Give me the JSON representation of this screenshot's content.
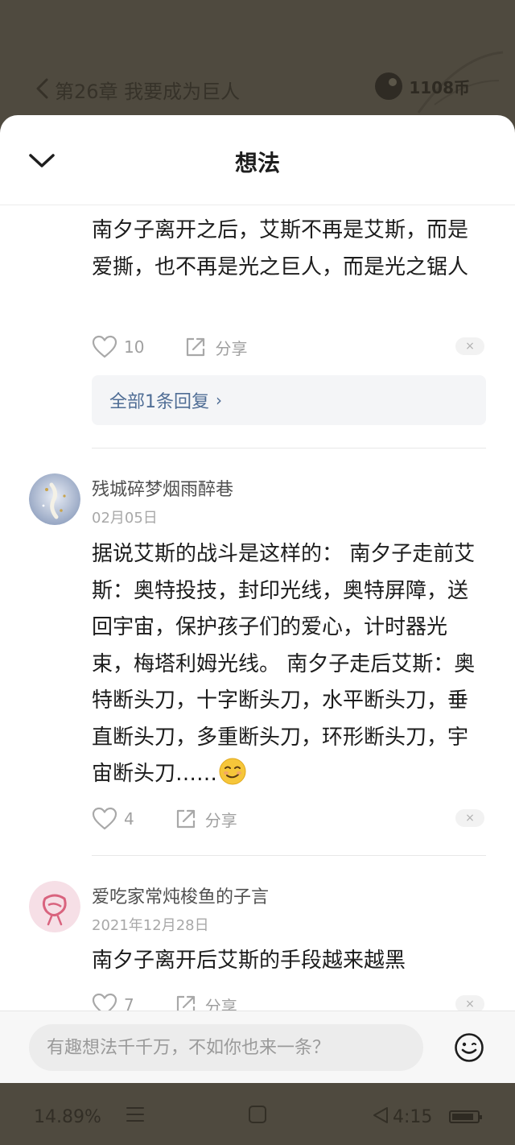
{
  "reader": {
    "chapter_title": "第26章 我要成为巨人",
    "coins": "1108币",
    "progress": "14.89%",
    "time": "4:15"
  },
  "sheet": {
    "title": "想法"
  },
  "comments": [
    {
      "text": "南夕子离开之后，艾斯不再是艾斯，而是爱撕，也不再是光之巨人，而是光之锯人",
      "likes": "10",
      "share_label": "分享",
      "reply_link": "全部1条回复"
    },
    {
      "username": "残城碎梦烟雨醉巷",
      "date": "02月05日",
      "text": "据说艾斯的战斗是这样的： 南夕子走前艾斯：奥特投技，封印光线，奥特屏障，送回宇宙，保护孩子们的爱心，计时器光束，梅塔利姆光线。 南夕子走后艾斯：奥特断头刀，十字断头刀，水平断头刀，垂直断头刀，多重断头刀，环形断头刀，宇宙断头刀……",
      "likes": "4",
      "share_label": "分享"
    },
    {
      "username": "爱吃家常炖梭鱼的子言",
      "date": "2021年12月28日",
      "text": "南夕子离开后艾斯的手段越来越黑",
      "likes": "7",
      "share_label": "分享"
    }
  ],
  "input": {
    "placeholder": "有趣想法千千万，不如你也来一条？"
  },
  "colors": {
    "link": "#4f6d95",
    "dim_background": "#4f4a3f"
  },
  "icons": {
    "back": "chevron-left-icon",
    "collapse": "chevron-down-icon",
    "like": "heart-outline-icon",
    "share": "share-icon",
    "emoji": "smiley-icon",
    "menu": "menu-icon",
    "home": "square-home-icon",
    "nav_back": "triangle-back-icon",
    "battery": "battery-icon"
  }
}
